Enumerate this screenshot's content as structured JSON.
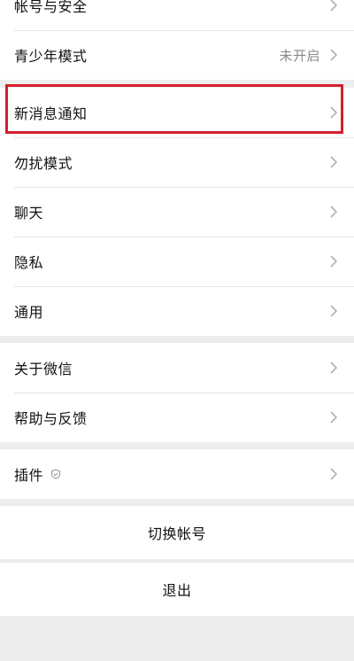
{
  "settings": {
    "group1": [
      {
        "label": "帐号与安全",
        "value": ""
      },
      {
        "label": "青少年模式",
        "value": "未开启"
      }
    ],
    "group2": [
      {
        "label": "新消息通知"
      },
      {
        "label": "勿扰模式"
      },
      {
        "label": "聊天"
      },
      {
        "label": "隐私"
      },
      {
        "label": "通用"
      }
    ],
    "group3": [
      {
        "label": "关于微信"
      },
      {
        "label": "帮助与反馈"
      }
    ],
    "group4": [
      {
        "label": "插件",
        "icon": "shield-icon"
      }
    ]
  },
  "actions": {
    "switch_account": "切换帐号",
    "logout": "退出"
  },
  "colors": {
    "highlight": "#d4202c",
    "background": "#ededed"
  }
}
